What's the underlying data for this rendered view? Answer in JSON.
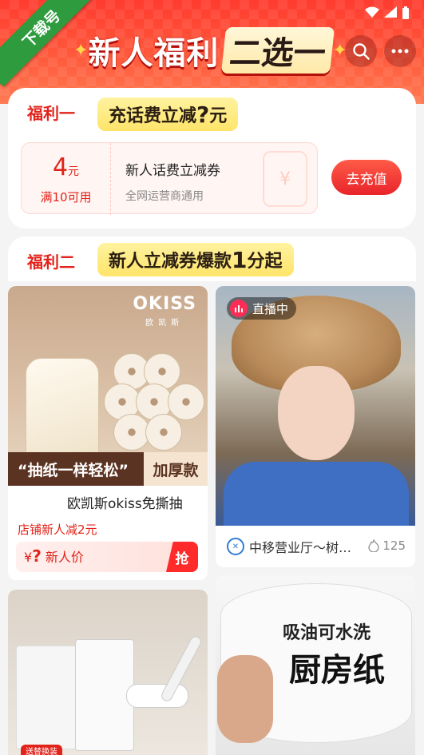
{
  "ribbon": {
    "label": "下载号"
  },
  "header": {
    "title": "新人福利",
    "subtitle": "二选一"
  },
  "benefit1": {
    "label": "福利一",
    "pill_text": "充话费立减",
    "pill_q": "?",
    "pill_unit": "元",
    "coupon": {
      "amount": "4",
      "unit": "元",
      "condition": "满10可用",
      "title": "新人话费立减券",
      "subtitle": "全网运营商通用"
    },
    "button": "去充值"
  },
  "benefit2": {
    "label": "福利二",
    "pill_text": "新人立减券爆款",
    "pill_num": "1",
    "pill_tail": "分起"
  },
  "products": {
    "p1": {
      "brand": "OKISS",
      "brand_cn": "欧凯斯",
      "slogan": "“抽纸一样轻松”",
      "badge": "加厚款",
      "title": "欧凯斯okiss免撕抽",
      "tag": "店铺新人减2元",
      "price_symbol": "¥",
      "price_q": "?",
      "price_label": "新人价",
      "grab": "抢"
    },
    "p2": {
      "live": "直播中",
      "shop": "中移营业厅～树…",
      "heat": "125"
    },
    "p3": {
      "tag": "送替换装"
    },
    "p4": {
      "line1": "吸油可水洗",
      "line2": "厨房纸"
    }
  },
  "colors": {
    "accent": "#e2231a",
    "header": "#ff3b2f",
    "pill": "#ffe46a",
    "ribbon": "#2e9b3f"
  }
}
